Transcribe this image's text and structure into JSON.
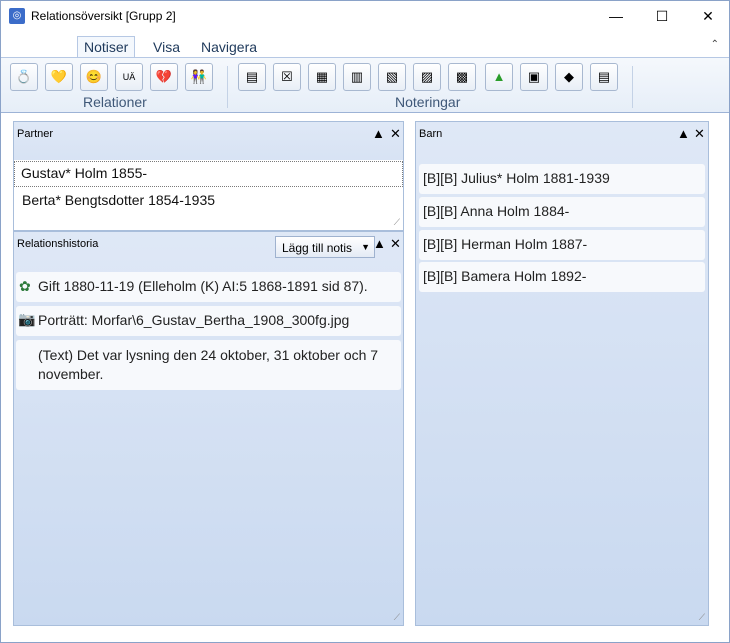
{
  "window": {
    "title": "Relationsöversikt [Grupp 2]",
    "minimize": "—",
    "maximize": "☐",
    "close": "✕"
  },
  "ribbon": {
    "tabs": [
      {
        "label": "Notiser"
      },
      {
        "label": "Visa"
      },
      {
        "label": "Navigera"
      }
    ],
    "collapse": "⌃",
    "groups": {
      "relationer": "Relationer",
      "noteringar": "Noteringar"
    }
  },
  "partner": {
    "title": "Partner",
    "rows": [
      "Gustav*  Holm  1855-",
      "Berta*  Bengtsdotter  1854-1935"
    ]
  },
  "history": {
    "title": "Relationshistoria",
    "add_button": "Lägg till notis",
    "entries": [
      "Gift 1880-11-19 (Elleholm (K) AI:5 1868-1891 sid 87).",
      "Porträtt: Morfar\\6_Gustav_Bertha_1908_300fg.jpg",
      "(Text) Det var lysning den 24 oktober, 31 oktober och 7 november."
    ]
  },
  "barn": {
    "title": "Barn",
    "rows": [
      "[B][B] Julius* Holm 1881-1939",
      "[B][B] Anna Holm 1884-",
      "[B][B] Herman Holm 1887-",
      "[B][B] Bamera Holm 1892-"
    ]
  },
  "icons": {
    "up": "▲",
    "close": "✕",
    "dropdown": "▼",
    "grip": "⟋"
  },
  "ribbon_buttons": {
    "ua": "UÄ"
  }
}
